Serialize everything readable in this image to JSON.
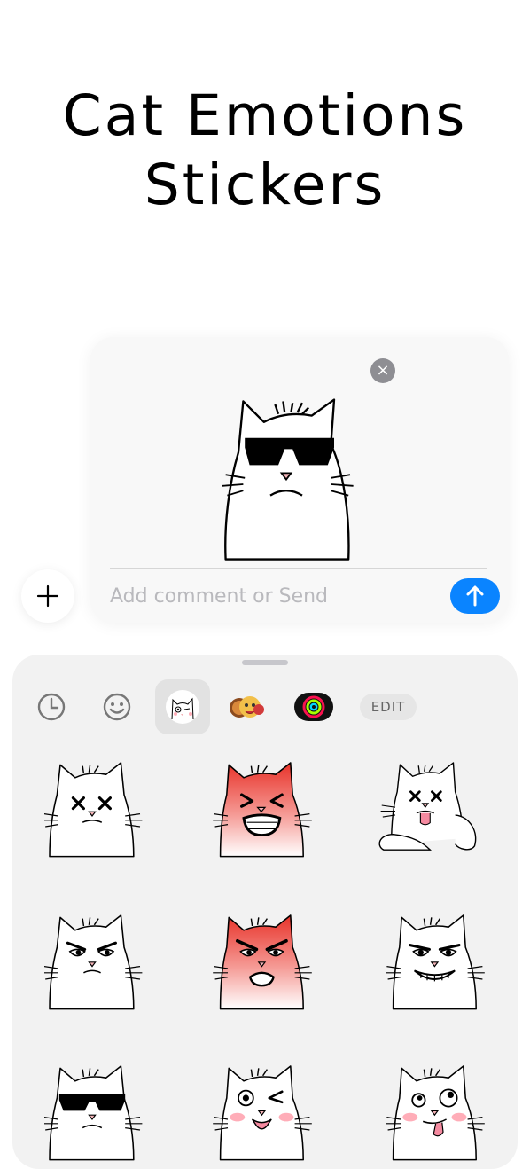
{
  "title": {
    "line1": "Cat Emotions",
    "line2": "Stickers"
  },
  "compose": {
    "close_icon": "×",
    "placeholder": "Add comment or Send",
    "preview_sticker": "cat-sunglasses-sticker"
  },
  "plus_icon": "plus-icon",
  "drawer": {
    "tabs": [
      "recents-icon",
      "emoji-icon",
      "cat-emotions-app-icon",
      "memoji-icon",
      "activity-rings-icon"
    ],
    "selected_tab": "cat-emotions-app-icon",
    "edit_label": "EDIT",
    "stickers": [
      "cat-dizzy",
      "cat-angry-shouting",
      "cat-dizzy-tongue",
      "cat-suspicious",
      "cat-furious",
      "cat-sly-grin",
      "cat-sunglasses",
      "cat-winking",
      "cat-silly-blush"
    ]
  },
  "colors": {
    "accent": "#0a84ff",
    "angry_red": "#e8332a",
    "blush": "#ff8a9a",
    "nose": "#f3b3b7"
  }
}
